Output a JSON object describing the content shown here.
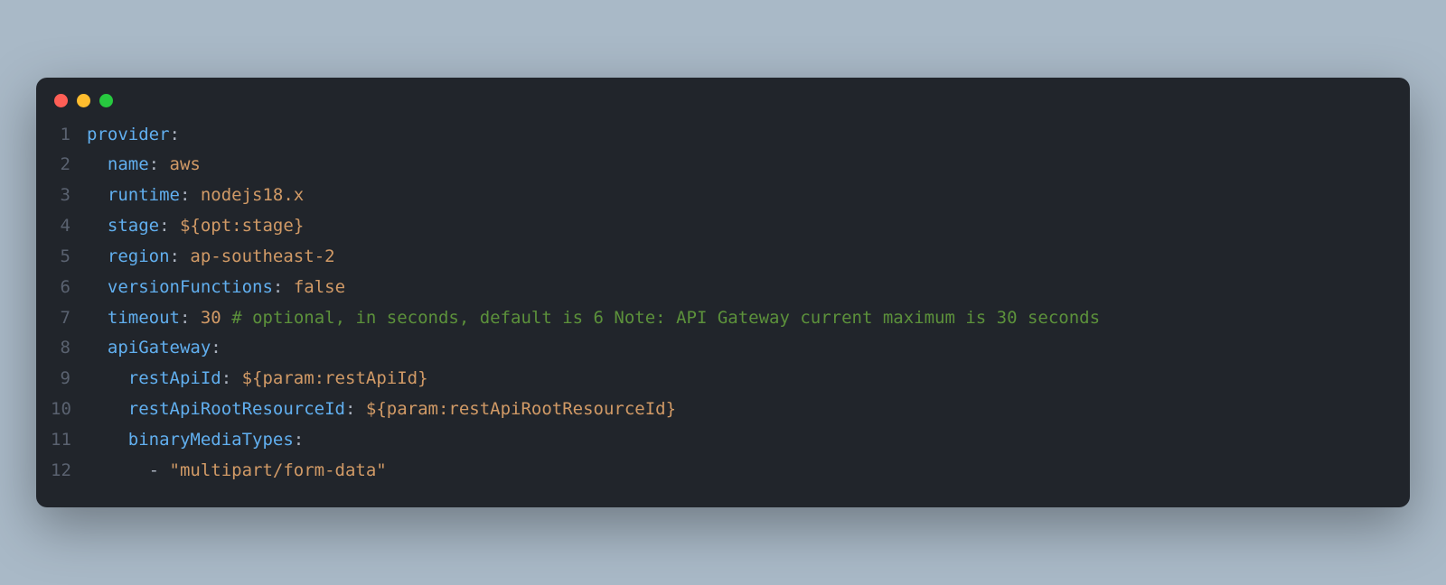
{
  "titlebar": {
    "close": "close",
    "minimize": "minimize",
    "maximize": "maximize"
  },
  "colors": {
    "bg_window": "#21252b",
    "bg_page": "#a9b9c7",
    "red": "#ff5f56",
    "yellow": "#ffbd2e",
    "green": "#27c93f",
    "lineno": "#5a6270",
    "key": "#61afef",
    "value": "#d19a66",
    "punct": "#abb2bf",
    "comment": "#5c913b"
  },
  "line_numbers": [
    "1",
    "2",
    "3",
    "4",
    "5",
    "6",
    "7",
    "8",
    "9",
    "10",
    "11",
    "12"
  ],
  "code": {
    "l1": {
      "key": "provider",
      "colon": ":"
    },
    "l2": {
      "indent": "  ",
      "key": "name",
      "colon": ": ",
      "val": "aws"
    },
    "l3": {
      "indent": "  ",
      "key": "runtime",
      "colon": ": ",
      "val": "nodejs18.x"
    },
    "l4": {
      "indent": "  ",
      "key": "stage",
      "colon": ": ",
      "val": "${opt:stage}"
    },
    "l5": {
      "indent": "  ",
      "key": "region",
      "colon": ": ",
      "val": "ap-southeast-2"
    },
    "l6": {
      "indent": "  ",
      "key": "versionFunctions",
      "colon": ": ",
      "val": "false"
    },
    "l7": {
      "indent": "  ",
      "key": "timeout",
      "colon": ": ",
      "val": "30 ",
      "comment": "# optional, in seconds, default is 6 Note: API Gateway current maximum is 30 seconds"
    },
    "l8": {
      "indent": "  ",
      "key": "apiGateway",
      "colon": ":"
    },
    "l9": {
      "indent": "    ",
      "key": "restApiId",
      "colon": ": ",
      "val": "${param:restApiId}"
    },
    "l10": {
      "indent": "    ",
      "key": "restApiRootResourceId",
      "colon": ": ",
      "val": "${param:restApiRootResourceId}"
    },
    "l11": {
      "indent": "    ",
      "key": "binaryMediaTypes",
      "colon": ":"
    },
    "l12": {
      "indent": "      ",
      "dash": "- ",
      "val": "\"multipart/form-data\""
    }
  }
}
